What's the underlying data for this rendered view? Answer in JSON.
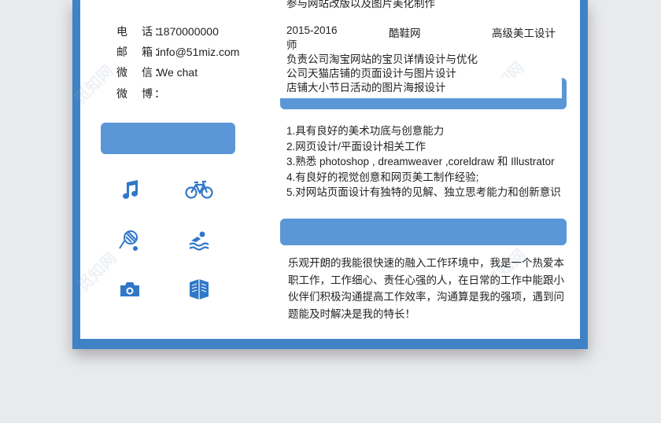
{
  "experience": {
    "prev_desc": "参与网站改版以及图片美化制作",
    "period": "2015-2016",
    "company": "酷鞋网",
    "position": "高级美工设计",
    "position_wrap": "师",
    "duties": [
      "负责公司淘宝网站的宝贝详情设计与优化",
      "公司天猫店铺的页面设计与图片设计",
      "店铺大小节日活动的图片海报设计"
    ]
  },
  "contact": {
    "phone_label": "电　话：",
    "phone": "1870000000",
    "email_label": "邮　箱：",
    "email": "info@51miz.com",
    "wechat_label": "微　信：",
    "wechat": "We chat",
    "weibo_label": "微　博：",
    "weibo": ""
  },
  "skills": [
    "1.具有良好的美术功底与创意能力",
    "2.网页设计/平面设计相关工作",
    "3.熟悉 photoshop , dreamweaver ,coreldraw 和 Illustrator",
    "4.有良好的视觉创意和网页美工制作经验;",
    "5.对网站页面设计有独特的见解、独立思考能力和创新意识"
  ],
  "self_eval": [
    "乐观开朗的我能很快速的融入工作环境中，我是一个热爱本",
    "职工作，工作细心、责任心强的人，在日常的工作中能跟小",
    "伙伴们积极沟通提高工作效率，沟通算是我的强项，遇到问",
    "题能及时解决是我的特长！"
  ],
  "hobby_icons": [
    "music-note",
    "bicycle",
    "tennis",
    "swimming",
    "camera",
    "books"
  ],
  "watermark": "觅知网",
  "colors": {
    "frame": "#3f82c6",
    "pill": "#5b97d6",
    "icon": "#2f78c8",
    "background": "#e9eaec"
  }
}
